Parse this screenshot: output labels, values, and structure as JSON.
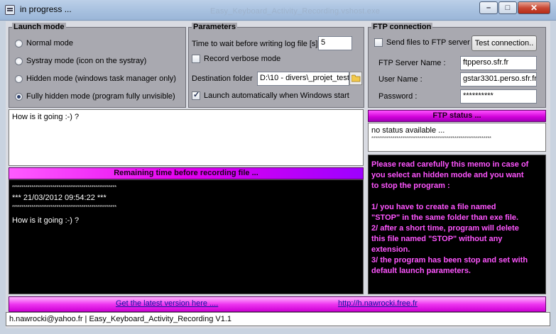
{
  "window": {
    "title": "in progress ...",
    "ghost_title": "Easy_Keyboard_Activity_Recording.vshost.exe",
    "min_glyph": "–",
    "max_glyph": "□",
    "close_glyph": "✕"
  },
  "launch_mode": {
    "title": "Launch mode",
    "options": [
      {
        "label": "Normal mode",
        "selected": false
      },
      {
        "label": "Systray mode (icon on the systray)",
        "selected": false
      },
      {
        "label": "Hidden mode (windows task manager only)",
        "selected": false
      },
      {
        "label": "Fully hidden mode (program fully unvisible)",
        "selected": true
      }
    ]
  },
  "parameters": {
    "title": "Parameters",
    "wait_label": "Time to wait before writing log file [s]",
    "wait_value": "5",
    "verbose_label": "Record verbose mode",
    "verbose_checked": false,
    "destination_label": "Destination folder",
    "destination_value": "D:\\10 - divers\\_projet_test",
    "autostart_label": "Launch automatically when Windows start",
    "autostart_checked": true
  },
  "ftp": {
    "title": "FTP connection",
    "send_label": "Send files to FTP server",
    "send_checked": false,
    "test_button": "Test connection..",
    "server_label": "FTP Server Name :",
    "server_value": "ftpperso.sfr.fr",
    "user_label": "User Name :",
    "user_value": "gstar3301.perso.sfr.fr",
    "password_label": "Password :",
    "password_value": "**********"
  },
  "input_text": "How is it going :-) ?",
  "ftp_status": {
    "title": "FTP status ...",
    "lines": [
      "no status available ...",
      "**************************************************************"
    ]
  },
  "recording": {
    "bar_label": "Remaining time before recording file ...",
    "progress_fraction": 0.5,
    "lines": [
      "******************************************************",
      "*** 21/03/2012 09:54:22 ***",
      "******************************************************",
      "How is it going :-) ?"
    ]
  },
  "memo": {
    "lines": [
      "Please read carefully this memo in case of",
      "you select an hidden mode and you want",
      "to stop the program :",
      "",
      "1/ you have to create a file named",
      "\"STOP\" in the same folder than exe file.",
      "2/ after a short time, program will delete",
      "this file named \"STOP\" without any",
      "extension.",
      "3/ the program has been stop and set with",
      "default launch parameters."
    ]
  },
  "links": {
    "latest": "Get the latest version here ....",
    "site": "http://h.nawrocki.free.fr"
  },
  "status": "h.nawrocki@yahoo.fr  |  Easy_Keyboard_Activity_Recording V1.1",
  "colors": {
    "accent": "#d000d8",
    "memo_text": "#ff55ff"
  }
}
